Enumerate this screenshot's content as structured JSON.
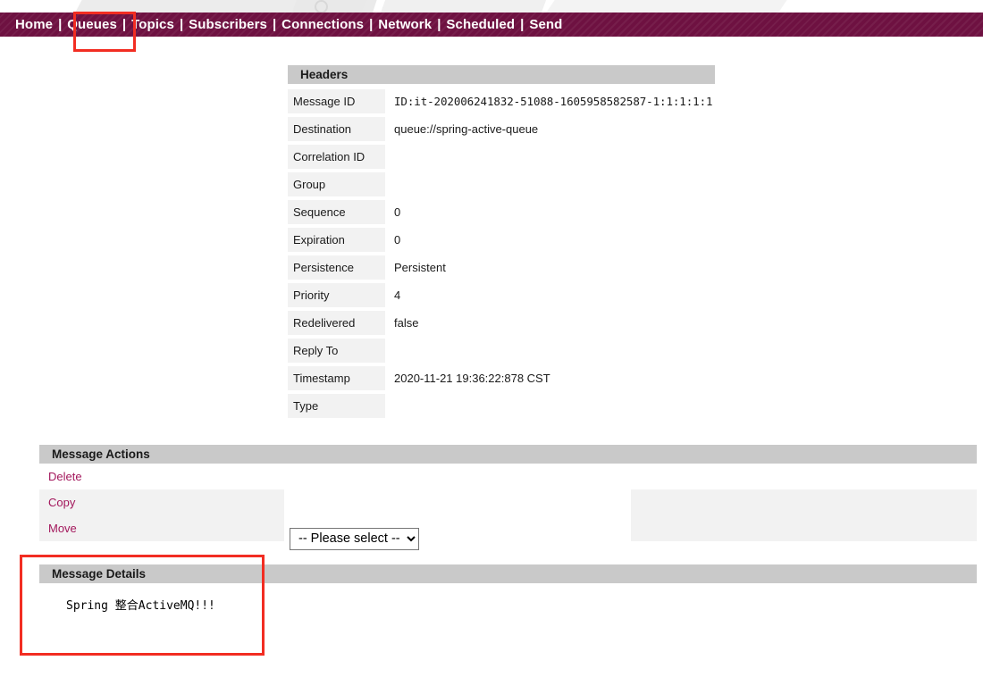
{
  "nav": {
    "items": [
      {
        "label": "Home",
        "name": "nav-home"
      },
      {
        "label": "Queues",
        "name": "nav-queues"
      },
      {
        "label": "Topics",
        "name": "nav-topics"
      },
      {
        "label": "Subscribers",
        "name": "nav-subscribers"
      },
      {
        "label": "Connections",
        "name": "nav-connections"
      },
      {
        "label": "Network",
        "name": "nav-network"
      },
      {
        "label": "Scheduled",
        "name": "nav-scheduled"
      },
      {
        "label": "Send",
        "name": "nav-send"
      }
    ],
    "separator": "|",
    "bar_color": "#6e1141",
    "highlighted_item": "Queues"
  },
  "headers": {
    "title": "Headers",
    "rows": [
      {
        "key": "Message ID",
        "value": "ID:it-202006241832-51088-1605958582587-1:1:1:1:1",
        "mono": true
      },
      {
        "key": "Destination",
        "value": "queue://spring-active-queue",
        "mono": false
      },
      {
        "key": "Correlation ID",
        "value": "",
        "mono": false
      },
      {
        "key": "Group",
        "value": "",
        "mono": false
      },
      {
        "key": "Sequence",
        "value": "0",
        "mono": false
      },
      {
        "key": "Expiration",
        "value": "0",
        "mono": false
      },
      {
        "key": "Persistence",
        "value": "Persistent",
        "mono": false
      },
      {
        "key": "Priority",
        "value": "4",
        "mono": false
      },
      {
        "key": "Redelivered",
        "value": "false",
        "mono": false
      },
      {
        "key": "Reply To",
        "value": "",
        "mono": false
      },
      {
        "key": "Timestamp",
        "value": "2020-11-21 19:36:22:878 CST",
        "mono": false
      },
      {
        "key": "Type",
        "value": "",
        "mono": false
      }
    ]
  },
  "message_actions": {
    "title": "Message Actions",
    "delete_label": "Delete",
    "copy_label": "Copy",
    "move_label": "Move",
    "select": {
      "selected": "-- Please select --",
      "options": [
        "-- Please select --"
      ]
    }
  },
  "message_details": {
    "title": "Message Details",
    "body": "Spring 整合ActiveMQ!!!"
  },
  "annotations": {
    "color": "#f22d22",
    "boxes": [
      "nav-queues",
      "message-details-panel"
    ]
  }
}
